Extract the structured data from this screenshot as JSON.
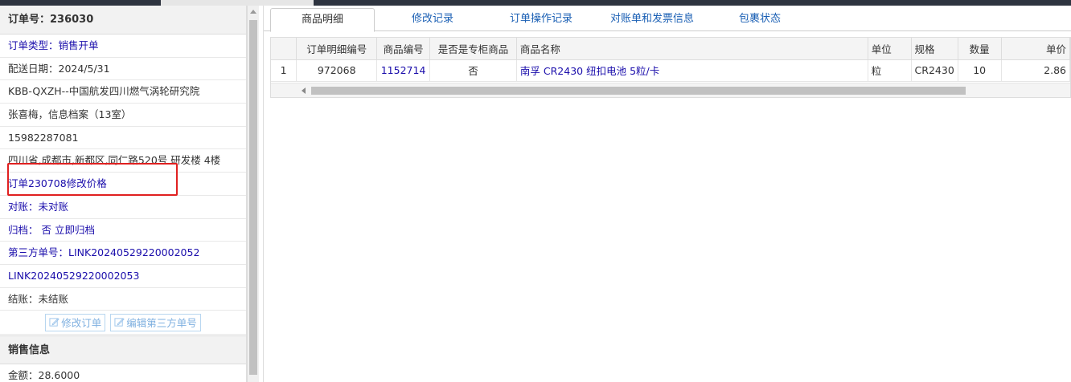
{
  "order": {
    "title": "订单号：236030",
    "rows": [
      {
        "text": "订单类型：销售开单",
        "style": "blue"
      },
      {
        "text": "配送日期：2024/5/31",
        "style": "dark"
      },
      {
        "text": "KBB-QXZH--中国航发四川燃气涡轮研究院",
        "style": "dark"
      },
      {
        "text": "张喜梅，信息档案（13室）",
        "style": "dark"
      },
      {
        "text": "15982287081",
        "style": "dark"
      },
      {
        "text": "四川省,成都市,新都区,同仁路520号 研发楼 4楼",
        "style": "dark"
      },
      {
        "text": "订单230708修改价格",
        "style": "blue"
      },
      {
        "text": "对账：未对账",
        "style": "blue"
      },
      {
        "text": "归档： 否 立即归档",
        "style": "blue"
      },
      {
        "text": "第三方单号：LINK20240529220002052",
        "style": "blue"
      },
      {
        "text": "LINK20240529220002053",
        "style": "blue"
      },
      {
        "text": "结账：未结账",
        "style": "dark"
      }
    ],
    "edit_order_label": "修改订单",
    "edit_third_party_label": "编辑第三方单号"
  },
  "sales": {
    "title": "销售信息",
    "amount": "金额：28.6000"
  },
  "tabs": [
    {
      "label": "商品明细",
      "active": true
    },
    {
      "label": "修改记录",
      "active": false
    },
    {
      "label": "订单操作记录",
      "active": false
    },
    {
      "label": "对账单和发票信息",
      "active": false
    },
    {
      "label": "包裹状态",
      "active": false
    }
  ],
  "table": {
    "headers": [
      "",
      "订单明细编号",
      "商品编号",
      "是否是专柜商品",
      "商品名称",
      "单位",
      "规格",
      "数量",
      "单价"
    ],
    "rows": [
      [
        "1",
        "972068",
        "1152714",
        "否",
        "南孚 CR2430 纽扣电池 5粒/卡",
        "粒",
        "CR2430",
        "10",
        "2.86"
      ]
    ]
  },
  "colors": {
    "link": "#1a0dab",
    "tab_link": "#1a5fb4",
    "highlight": "#e02020"
  }
}
